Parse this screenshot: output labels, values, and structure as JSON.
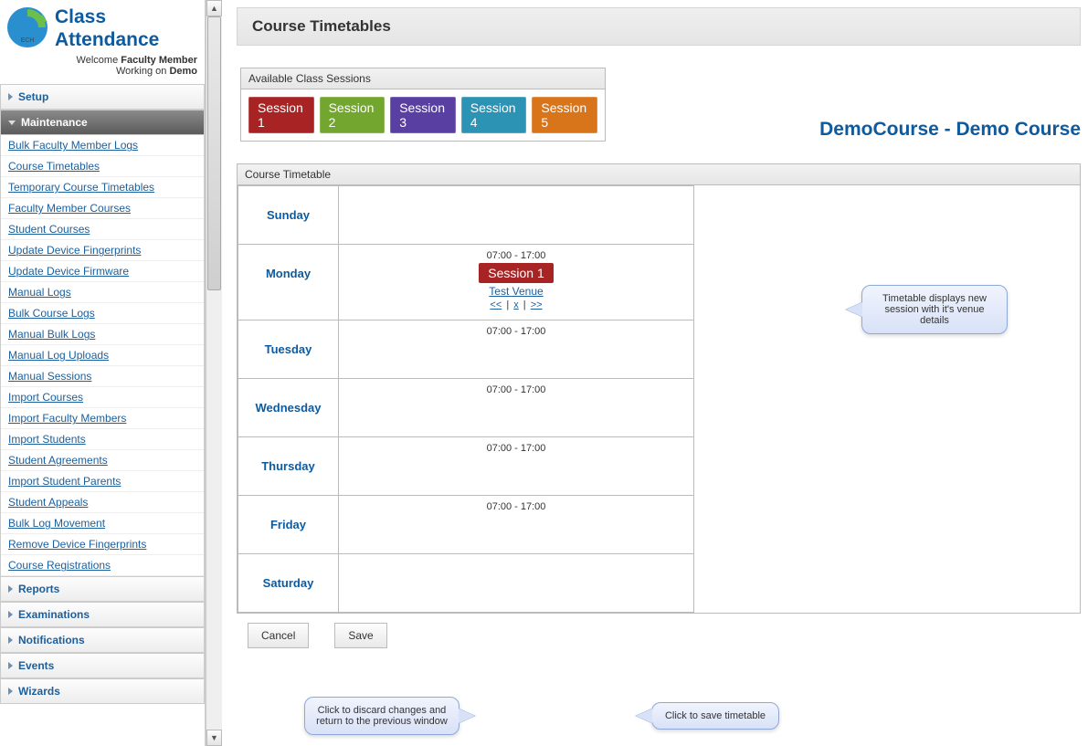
{
  "header": {
    "app_title_line1": "Class",
    "app_title_line2": "Attendance",
    "welcome_prefix": "Welcome ",
    "welcome_user": "Faculty Member",
    "working_on_prefix": "Working on ",
    "working_on_value": "Demo"
  },
  "sidebar": {
    "groups": [
      {
        "label": "Setup",
        "expanded": false
      },
      {
        "label": "Maintenance",
        "expanded": true
      },
      {
        "label": "Reports",
        "expanded": false
      },
      {
        "label": "Examinations",
        "expanded": false
      },
      {
        "label": "Notifications",
        "expanded": false
      },
      {
        "label": "Events",
        "expanded": false
      },
      {
        "label": "Wizards",
        "expanded": false
      }
    ],
    "maintenance_items": [
      "Bulk Faculty Member Logs",
      "Course Timetables",
      "Temporary Course Timetables",
      "Faculty Member Courses",
      "Student Courses",
      "Update Device Fingerprints",
      "Update Device Firmware",
      "Manual Logs",
      "Bulk Course Logs",
      "Manual Bulk Logs",
      "Manual Log Uploads",
      "Manual Sessions",
      "Import Courses",
      "Import Faculty Members",
      "Import Students",
      "Student Agreements",
      "Import Student Parents",
      "Student Appeals",
      "Bulk Log Movement",
      "Remove Device Fingerprints",
      "Course Registrations"
    ]
  },
  "page": {
    "title": "Course Timetables",
    "course_label": "DemoCourse - Demo Course"
  },
  "sessions_panel": {
    "header": "Available Class Sessions",
    "sessions": [
      "Session 1",
      "Session 2",
      "Session 3",
      "Session 4",
      "Session 5"
    ]
  },
  "timetable": {
    "header": "Course Timetable",
    "days": [
      {
        "name": "Sunday",
        "time": ""
      },
      {
        "name": "Monday",
        "time": "07:00 - 17:00",
        "session": "Session 1",
        "venue": "Test Venue"
      },
      {
        "name": "Tuesday",
        "time": "07:00 - 17:00"
      },
      {
        "name": "Wednesday",
        "time": "07:00 - 17:00"
      },
      {
        "name": "Thursday",
        "time": "07:00 - 17:00"
      },
      {
        "name": "Friday",
        "time": "07:00 - 17:00"
      },
      {
        "name": "Saturday",
        "time": ""
      }
    ],
    "controls": {
      "prev": "<<",
      "sep": "|",
      "del": "x",
      "next": ">>"
    }
  },
  "buttons": {
    "cancel": "Cancel",
    "save": "Save"
  },
  "callouts": {
    "session": "Timetable displays new session with it's venue details",
    "cancel": "Click to discard changes and return to the previous window",
    "save": "Click to save timetable"
  }
}
